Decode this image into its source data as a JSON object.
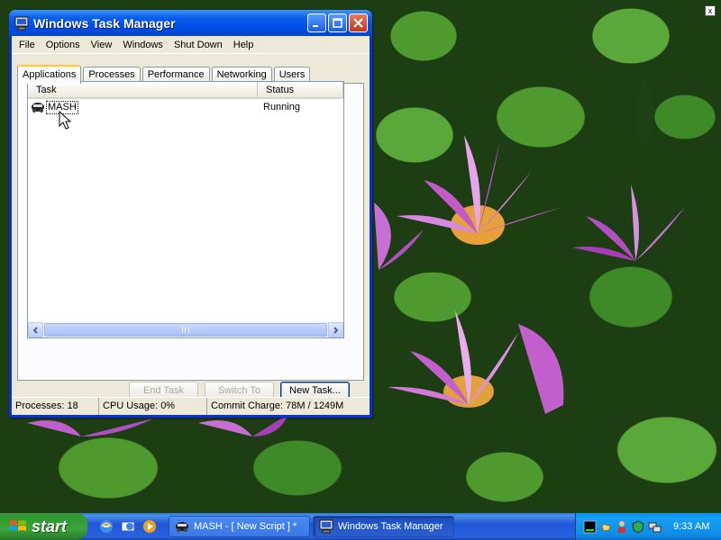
{
  "window": {
    "title": "Windows Task Manager"
  },
  "menu": [
    "File",
    "Options",
    "View",
    "Windows",
    "Shut Down",
    "Help"
  ],
  "tabs": [
    "Applications",
    "Processes",
    "Performance",
    "Networking",
    "Users"
  ],
  "list": {
    "columns": [
      "Task",
      "Status"
    ],
    "rows": [
      {
        "task": "MASH",
        "status": "Running"
      }
    ]
  },
  "buttons": {
    "end_task": "End Task",
    "switch_to": "Switch To",
    "new_task": "New Task..."
  },
  "statusbar": {
    "processes": "Processes: 18",
    "cpu": "CPU Usage: 0%",
    "commit": "Commit Charge: 78M / 1249M"
  },
  "desktop": {
    "corner_box": "x"
  },
  "taskbar": {
    "start_label": "start",
    "tasks": [
      {
        "label": "MASH - [ New Script ] *",
        "active": false
      },
      {
        "label": "Windows Task Manager",
        "active": true
      }
    ],
    "clock": "9:33 AM"
  },
  "colors": {
    "titlebar": "#0a5fe8",
    "taskbar": "#2157d7",
    "start_button": "#3aa33a",
    "tray": "#0f8ee8"
  }
}
